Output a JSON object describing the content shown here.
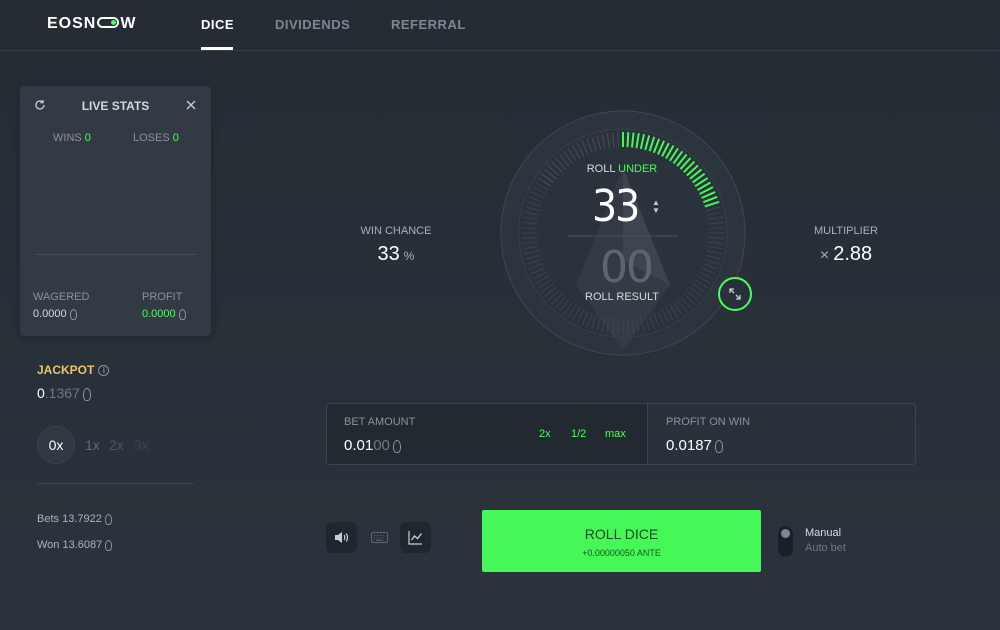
{
  "header": {
    "logo": {
      "pre": "EOSN",
      "post": "W"
    },
    "tabs": [
      {
        "label": "DICE",
        "active": true
      },
      {
        "label": "DIVIDENDS",
        "active": false
      },
      {
        "label": "REFERRAL",
        "active": false
      }
    ]
  },
  "live_stats": {
    "title": "LIVE STATS",
    "wins_label": "WINS",
    "wins_value": "0",
    "loses_label": "LOSES",
    "loses_value": "0",
    "wagered_label": "WAGERED",
    "wagered_value": "0.0000",
    "profit_label": "PROFIT",
    "profit_value": "0.0000"
  },
  "jackpot": {
    "label": "JACKPOT",
    "value_main": "0",
    "value_rest": ".1367",
    "multipliers": [
      "0x",
      "1x",
      "2x",
      "3x"
    ],
    "bets_label": "Bets",
    "bets_value": "13.7922",
    "won_label": "Won",
    "won_value": "13.6087"
  },
  "dice": {
    "roll_label": "ROLL",
    "under_label": "UNDER",
    "roll_value": "33",
    "result_value": "00",
    "result_label": "ROLL RESULT",
    "win_chance_label": "WIN CHANCE",
    "win_chance_value": "33",
    "win_chance_unit": "%",
    "multiplier_label": "MULTIPLIER",
    "multiplier_prefix": "×",
    "multiplier_value": "2.88"
  },
  "bet": {
    "amount_label": "BET AMOUNT",
    "amount_main": "0.01",
    "amount_dim": "00",
    "btn_double": "2x",
    "btn_half": "1/2",
    "btn_max": "max",
    "profit_label": "PROFIT ON WIN",
    "profit_value": "0.0187"
  },
  "roll": {
    "label": "ROLL DICE",
    "sub": "+0.00000050 ANTE"
  },
  "mode": {
    "manual": "Manual",
    "auto": "Auto bet"
  },
  "colors": {
    "accent_green": "#46f758",
    "jackpot_gold": "#f0c26a",
    "background": "#2b333c"
  }
}
